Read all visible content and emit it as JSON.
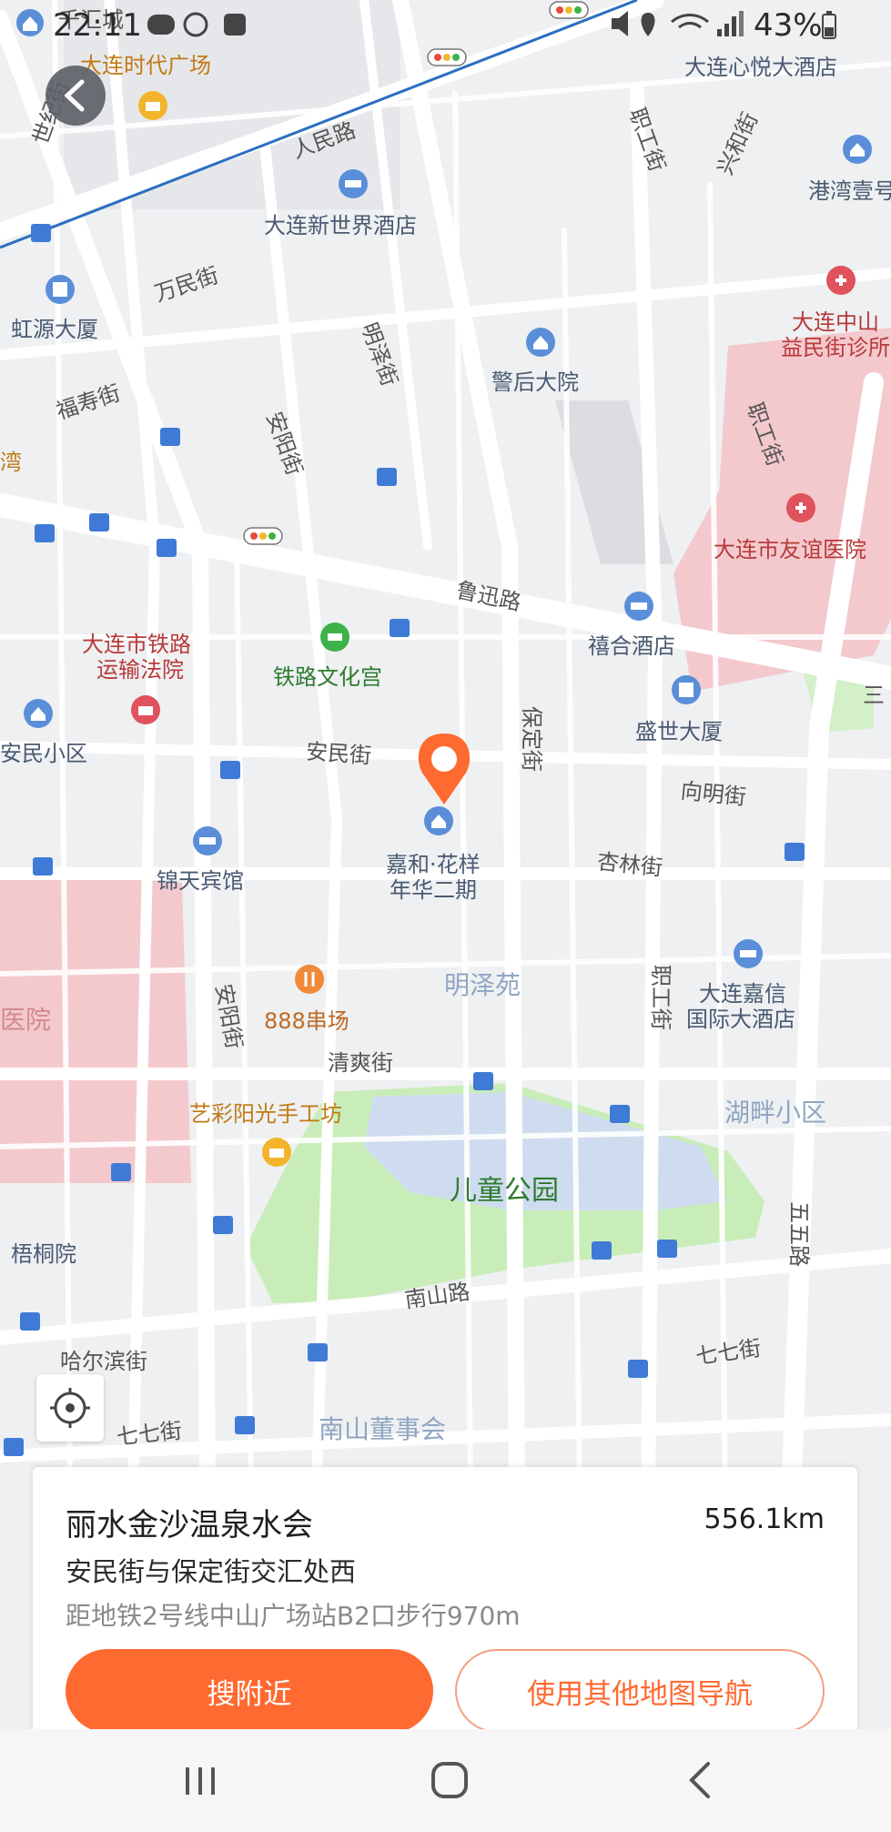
{
  "status_bar": {
    "time": "22:11",
    "battery_text": "43%"
  },
  "map": {
    "labels": {
      "qianhuicheng": "千汇城",
      "shidai_plaza": "大连时代广场",
      "xinyue_hotel": "大连心悦大酒店",
      "shiji_st": "世纪街",
      "renmin_rd": "人民路",
      "zhigong_st_1": "职工街",
      "xinghe_st": "兴和街",
      "gangwan": "港湾壹号",
      "new_world_hotel": "大连新世界酒店",
      "wanmin_st": "万民街",
      "hongyuan": "虹源大厦",
      "zhongshan_clinic_1": "大连中山",
      "zhongshan_clinic_2": "益民街诊所",
      "fushou_st": "福寿街",
      "mingze_st": "明泽街",
      "jinghou": "警后大院",
      "anyang_st_1": "安阳街",
      "zhigong_st_2": "职工街",
      "wan": "湾",
      "youyi_hospital": "大连市友谊医院",
      "luxun_rd": "鲁迅路",
      "railway_court_1": "大连市铁路",
      "railway_court_2": "运输法院",
      "railway_palace": "铁路文化宫",
      "xihe_hotel": "禧合酒店",
      "baoding_st": "保定街",
      "shengshi": "盛世大厦",
      "san": "三",
      "anmin_area": "安民小区",
      "anmin_st": "安民街",
      "xiangming_st": "向明街",
      "jiahe_1": "嘉和·花样",
      "jiahe_2": "年华二期",
      "jintian_hotel": "锦天宾馆",
      "xinglin_st": "杏林街",
      "mingze_yuan": "明泽苑",
      "zhigong_st_3": "职工街",
      "jiaxin_1": "大连嘉信",
      "jiaxin_2": "国际大酒店",
      "hospital_left": "医院",
      "anyang_st_2": "安阳街",
      "chuanchang": "888串场",
      "qingshuang_st": "清爽街",
      "yicai": "艺彩阳光手工坊",
      "hupan": "湖畔小区",
      "children_park": "儿童公园",
      "wuwu_rd": "五五路",
      "wutong": "梧桐院",
      "nanshan_rd": "南山路",
      "harbin_st": "哈尔滨街",
      "qiqi_st_1": "七七街",
      "qiqi_st_2": "七七街",
      "nanshan_dongshi": "南山董事会"
    }
  },
  "card": {
    "name": "丽水金沙温泉水会",
    "distance": "556.1km",
    "address": "安民街与保定街交汇处西",
    "transit": "距地铁2号线中山广场站B2口步行970m",
    "btn_nearby": "搜附近",
    "btn_other_map": "使用其他地图导航"
  },
  "colors": {
    "accent": "#ff6a31",
    "park": "#c9edb9",
    "water": "#cfdcef",
    "hospital_area": "#f3c9cd",
    "road": "#ffffff",
    "background": "#eef0f2"
  }
}
